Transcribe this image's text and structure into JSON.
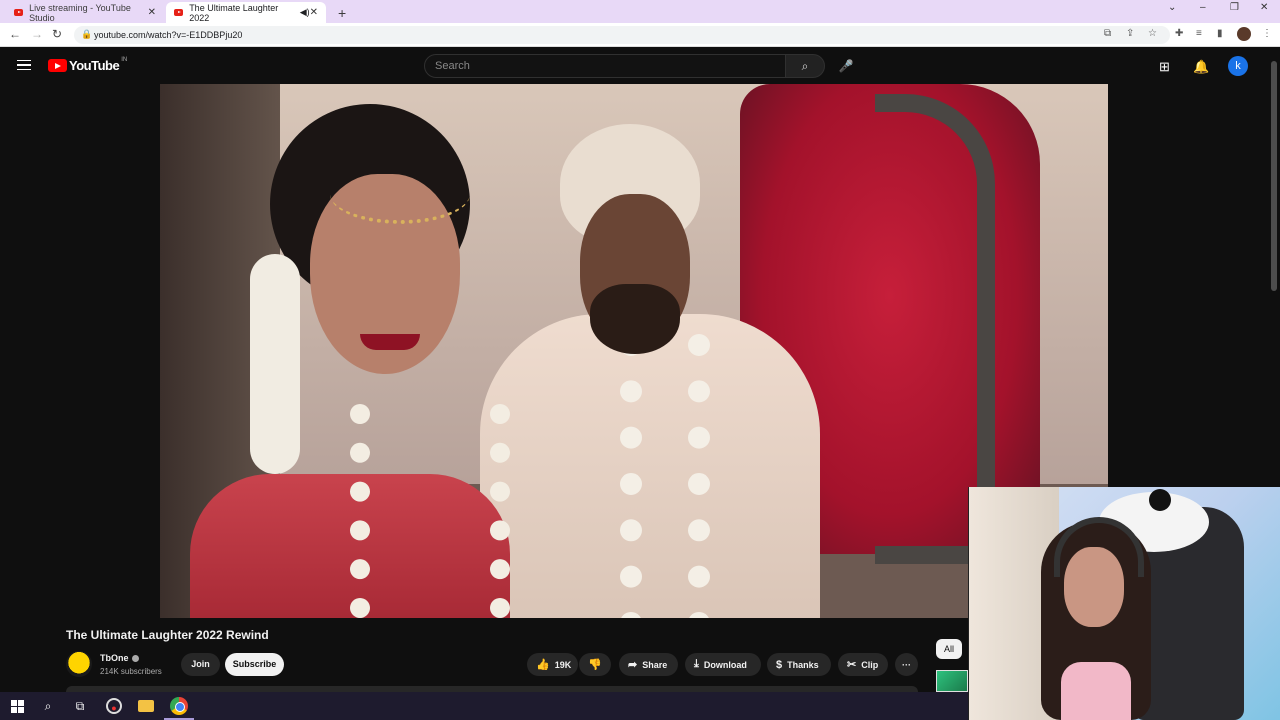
{
  "browser": {
    "tabs": [
      {
        "title": "Live streaming - YouTube Studio",
        "active": false
      },
      {
        "title": "The Ultimate Laughter 2022",
        "active": true
      }
    ],
    "new_tab": "+",
    "url": "youtube.com/watch?v=-E1DDBPju20",
    "window_controls": {
      "chevron": "⌄",
      "minimize": "–",
      "restore": "❐",
      "close": "✕"
    }
  },
  "youtube": {
    "logo_text": "YouTube",
    "country_code": "IN",
    "search_placeholder": "Search",
    "avatar_letter": "k"
  },
  "video": {
    "title": "The Ultimate Laughter 2022 Rewind",
    "channel": "TbOne",
    "subscribers": "214K subscribers",
    "join_label": "Join",
    "subscribe_label": "Subscribe",
    "likes": "19K",
    "share_label": "Share",
    "download_label": "Download",
    "thanks_label": "Thanks",
    "clip_label": "Clip",
    "more_label": "···"
  },
  "sidebar": {
    "chip_all": "All"
  },
  "colors": {
    "tab_strip": "#e8d9f7",
    "yt_bg": "#0f0f0f",
    "yt_red": "#ff0000",
    "avatar_blue": "#1a73e8"
  }
}
